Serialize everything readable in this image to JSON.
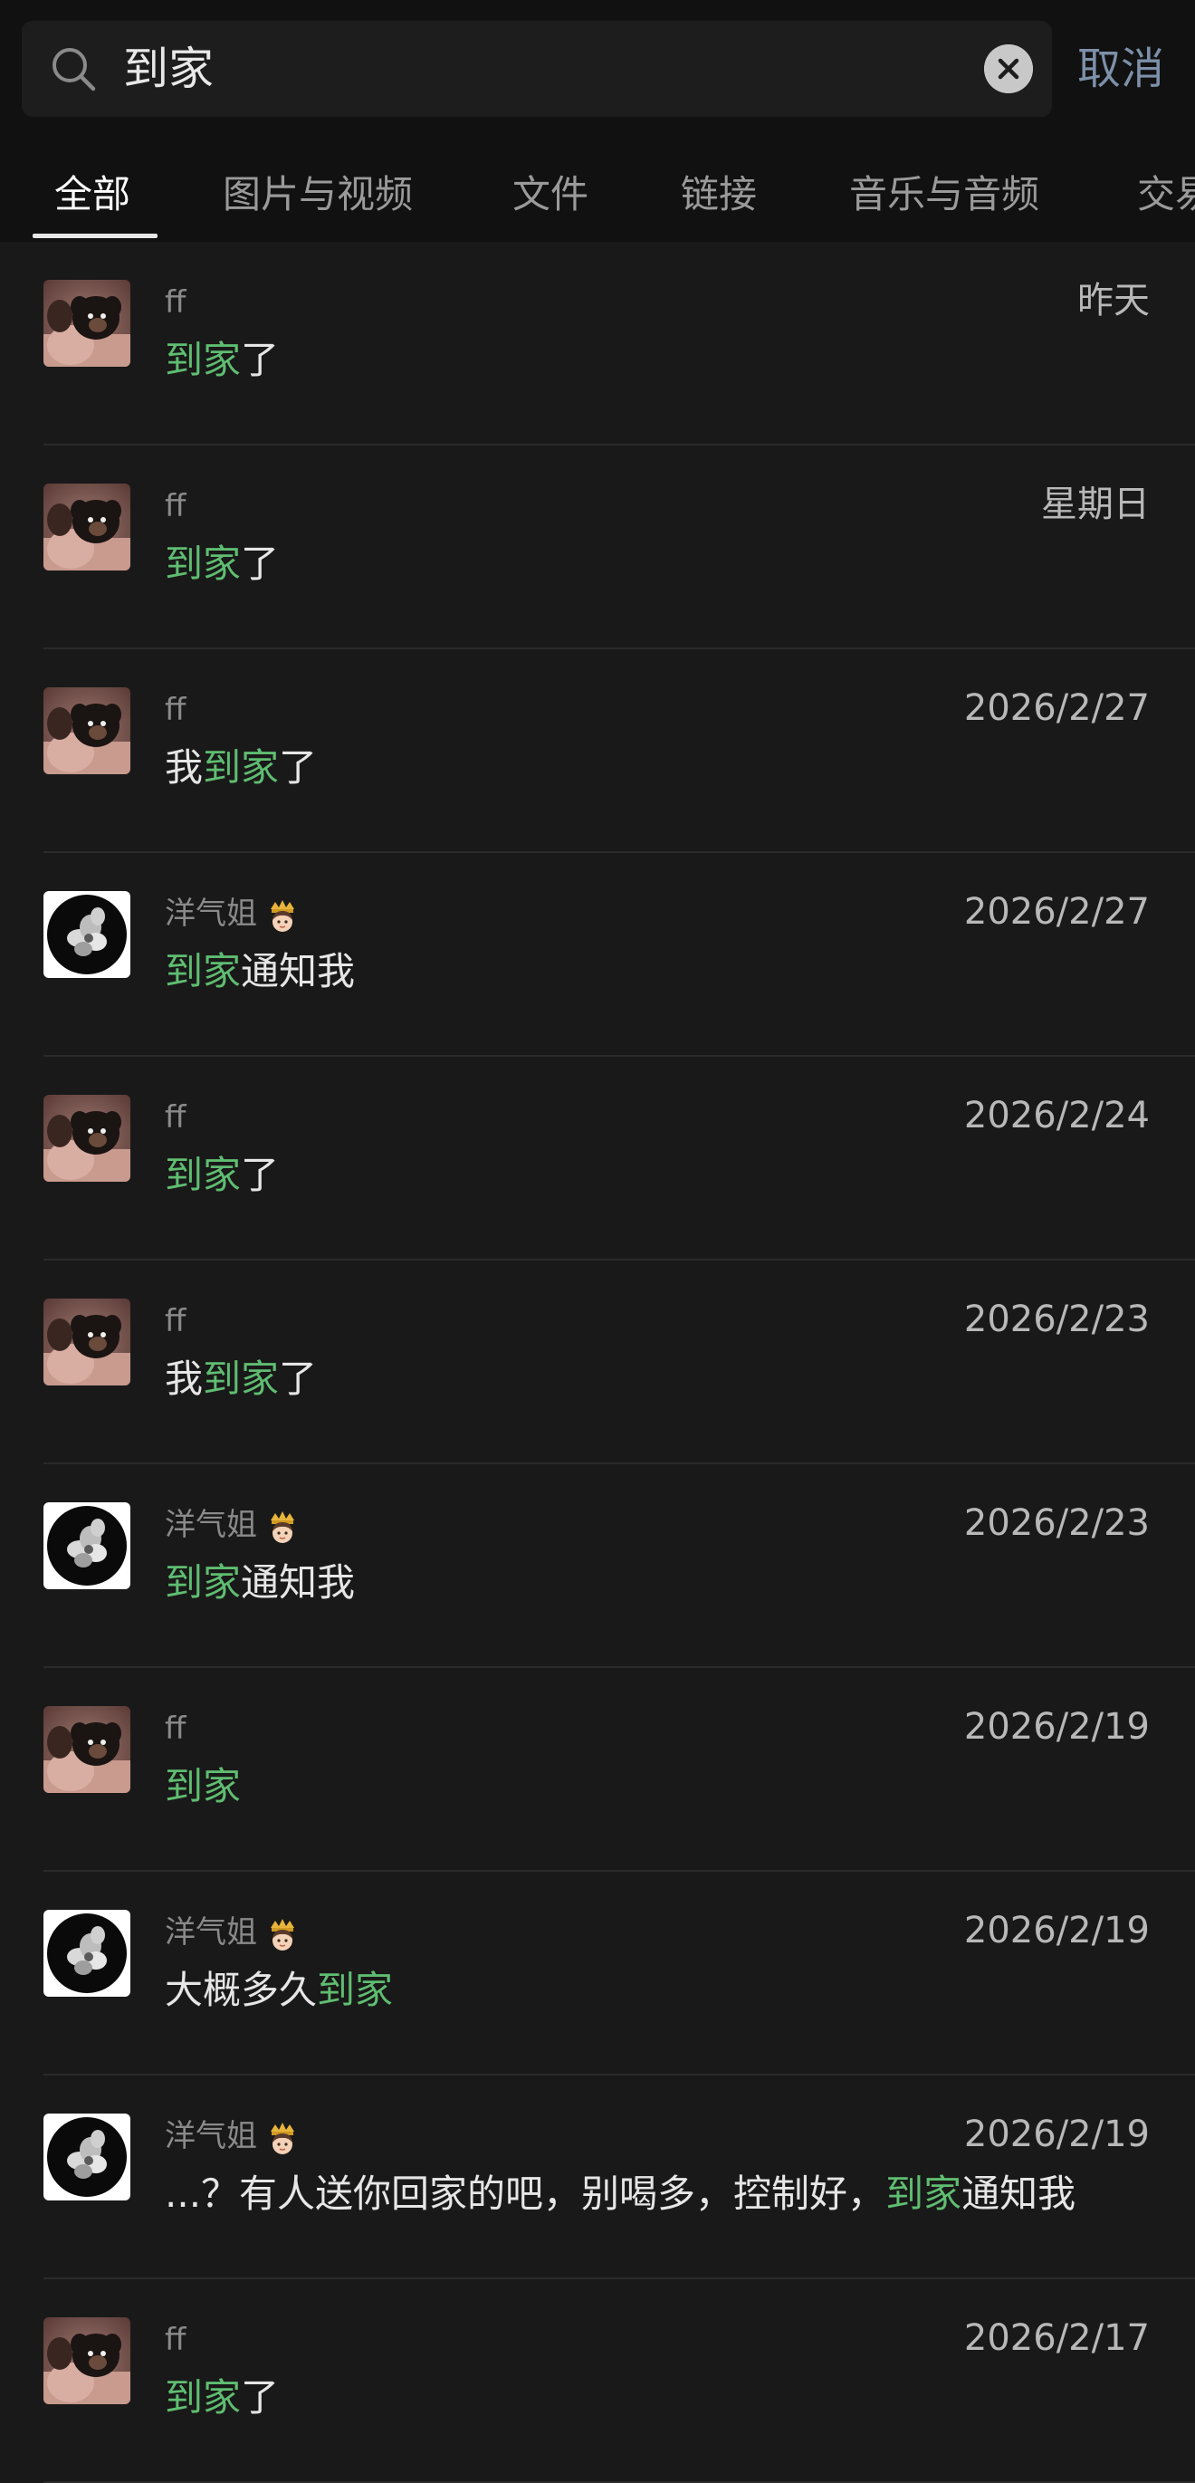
{
  "search": {
    "query": "到家",
    "cancel_label": "取消"
  },
  "tabs": [
    {
      "label": "全部",
      "active": true
    },
    {
      "label": "图片与视频",
      "active": false
    },
    {
      "label": "文件",
      "active": false
    },
    {
      "label": "链接",
      "active": false
    },
    {
      "label": "音乐与音频",
      "active": false
    },
    {
      "label": "交易",
      "active": false
    }
  ],
  "colors": {
    "background": "#191919",
    "highlight": "#5fbd71",
    "cancel": "#7d90a9"
  },
  "results": [
    {
      "sender": "ff",
      "avatar": "dog-photo-avatar",
      "date": "昨天",
      "parts": [
        {
          "text": "到家",
          "hl": true
        },
        {
          "text": "了",
          "hl": false
        }
      ]
    },
    {
      "sender": "ff",
      "avatar": "dog-photo-avatar",
      "date": "星期日",
      "parts": [
        {
          "text": "到家",
          "hl": true
        },
        {
          "text": "了",
          "hl": false
        }
      ]
    },
    {
      "sender": "ff",
      "avatar": "dog-photo-avatar",
      "date": "2026/2/27",
      "parts": [
        {
          "text": "我",
          "hl": false
        },
        {
          "text": "到家",
          "hl": true
        },
        {
          "text": "了",
          "hl": false
        }
      ]
    },
    {
      "sender": "洋气姐",
      "avatar": "flower-avatar",
      "crown": true,
      "date": "2026/2/27",
      "parts": [
        {
          "text": "到家",
          "hl": true
        },
        {
          "text": "通知我",
          "hl": false
        }
      ]
    },
    {
      "sender": "ff",
      "avatar": "dog-photo-avatar",
      "date": "2026/2/24",
      "parts": [
        {
          "text": "到家",
          "hl": true
        },
        {
          "text": "了",
          "hl": false
        }
      ]
    },
    {
      "sender": "ff",
      "avatar": "dog-photo-avatar",
      "date": "2026/2/23",
      "parts": [
        {
          "text": "我",
          "hl": false
        },
        {
          "text": "到家",
          "hl": true
        },
        {
          "text": "了",
          "hl": false
        }
      ]
    },
    {
      "sender": "洋气姐",
      "avatar": "flower-avatar",
      "crown": true,
      "date": "2026/2/23",
      "parts": [
        {
          "text": "到家",
          "hl": true
        },
        {
          "text": "通知我",
          "hl": false
        }
      ]
    },
    {
      "sender": "ff",
      "avatar": "dog-photo-avatar",
      "date": "2026/2/19",
      "parts": [
        {
          "text": "到家",
          "hl": true
        }
      ]
    },
    {
      "sender": "洋气姐",
      "avatar": "flower-avatar",
      "crown": true,
      "date": "2026/2/19",
      "parts": [
        {
          "text": "大概多久",
          "hl": false
        },
        {
          "text": "到家",
          "hl": true
        }
      ]
    },
    {
      "sender": "洋气姐",
      "avatar": "flower-avatar",
      "crown": true,
      "date": "2026/2/19",
      "parts": [
        {
          "text": "...？有人送你回家的吧，别喝多，控制好，",
          "hl": false
        },
        {
          "text": "到家",
          "hl": true
        },
        {
          "text": "通知我",
          "hl": false
        }
      ]
    },
    {
      "sender": "ff",
      "avatar": "dog-photo-avatar",
      "date": "2026/2/17",
      "parts": [
        {
          "text": "到家",
          "hl": true
        },
        {
          "text": "了",
          "hl": false
        }
      ]
    }
  ]
}
